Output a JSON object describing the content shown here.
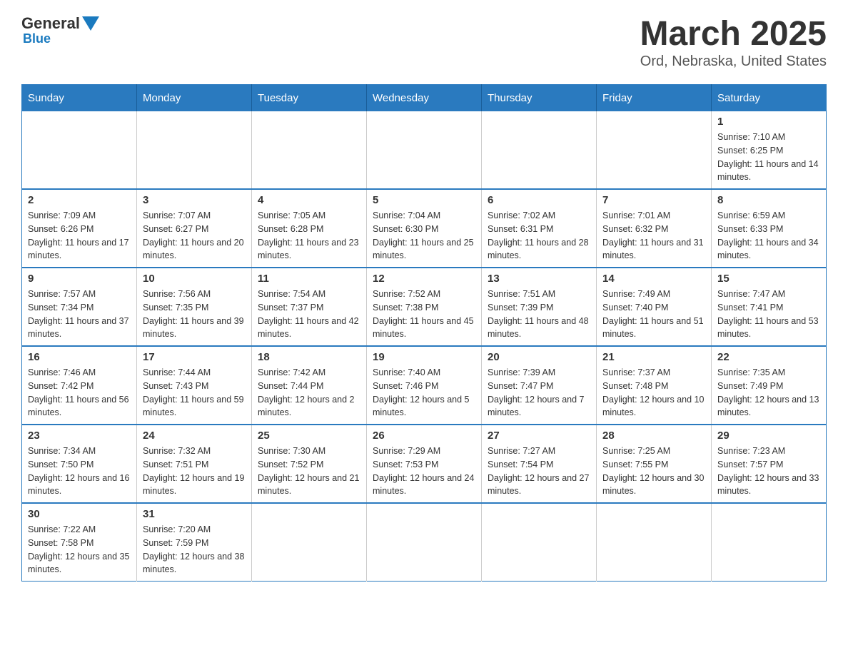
{
  "header": {
    "logo_general": "General",
    "logo_blue": "Blue",
    "main_title": "March 2025",
    "subtitle": "Ord, Nebraska, United States"
  },
  "days_of_week": [
    "Sunday",
    "Monday",
    "Tuesday",
    "Wednesday",
    "Thursday",
    "Friday",
    "Saturday"
  ],
  "weeks": [
    [
      {
        "day": "",
        "info": ""
      },
      {
        "day": "",
        "info": ""
      },
      {
        "day": "",
        "info": ""
      },
      {
        "day": "",
        "info": ""
      },
      {
        "day": "",
        "info": ""
      },
      {
        "day": "",
        "info": ""
      },
      {
        "day": "1",
        "info": "Sunrise: 7:10 AM\nSunset: 6:25 PM\nDaylight: 11 hours and 14 minutes."
      }
    ],
    [
      {
        "day": "2",
        "info": "Sunrise: 7:09 AM\nSunset: 6:26 PM\nDaylight: 11 hours and 17 minutes."
      },
      {
        "day": "3",
        "info": "Sunrise: 7:07 AM\nSunset: 6:27 PM\nDaylight: 11 hours and 20 minutes."
      },
      {
        "day": "4",
        "info": "Sunrise: 7:05 AM\nSunset: 6:28 PM\nDaylight: 11 hours and 23 minutes."
      },
      {
        "day": "5",
        "info": "Sunrise: 7:04 AM\nSunset: 6:30 PM\nDaylight: 11 hours and 25 minutes."
      },
      {
        "day": "6",
        "info": "Sunrise: 7:02 AM\nSunset: 6:31 PM\nDaylight: 11 hours and 28 minutes."
      },
      {
        "day": "7",
        "info": "Sunrise: 7:01 AM\nSunset: 6:32 PM\nDaylight: 11 hours and 31 minutes."
      },
      {
        "day": "8",
        "info": "Sunrise: 6:59 AM\nSunset: 6:33 PM\nDaylight: 11 hours and 34 minutes."
      }
    ],
    [
      {
        "day": "9",
        "info": "Sunrise: 7:57 AM\nSunset: 7:34 PM\nDaylight: 11 hours and 37 minutes."
      },
      {
        "day": "10",
        "info": "Sunrise: 7:56 AM\nSunset: 7:35 PM\nDaylight: 11 hours and 39 minutes."
      },
      {
        "day": "11",
        "info": "Sunrise: 7:54 AM\nSunset: 7:37 PM\nDaylight: 11 hours and 42 minutes."
      },
      {
        "day": "12",
        "info": "Sunrise: 7:52 AM\nSunset: 7:38 PM\nDaylight: 11 hours and 45 minutes."
      },
      {
        "day": "13",
        "info": "Sunrise: 7:51 AM\nSunset: 7:39 PM\nDaylight: 11 hours and 48 minutes."
      },
      {
        "day": "14",
        "info": "Sunrise: 7:49 AM\nSunset: 7:40 PM\nDaylight: 11 hours and 51 minutes."
      },
      {
        "day": "15",
        "info": "Sunrise: 7:47 AM\nSunset: 7:41 PM\nDaylight: 11 hours and 53 minutes."
      }
    ],
    [
      {
        "day": "16",
        "info": "Sunrise: 7:46 AM\nSunset: 7:42 PM\nDaylight: 11 hours and 56 minutes."
      },
      {
        "day": "17",
        "info": "Sunrise: 7:44 AM\nSunset: 7:43 PM\nDaylight: 11 hours and 59 minutes."
      },
      {
        "day": "18",
        "info": "Sunrise: 7:42 AM\nSunset: 7:44 PM\nDaylight: 12 hours and 2 minutes."
      },
      {
        "day": "19",
        "info": "Sunrise: 7:40 AM\nSunset: 7:46 PM\nDaylight: 12 hours and 5 minutes."
      },
      {
        "day": "20",
        "info": "Sunrise: 7:39 AM\nSunset: 7:47 PM\nDaylight: 12 hours and 7 minutes."
      },
      {
        "day": "21",
        "info": "Sunrise: 7:37 AM\nSunset: 7:48 PM\nDaylight: 12 hours and 10 minutes."
      },
      {
        "day": "22",
        "info": "Sunrise: 7:35 AM\nSunset: 7:49 PM\nDaylight: 12 hours and 13 minutes."
      }
    ],
    [
      {
        "day": "23",
        "info": "Sunrise: 7:34 AM\nSunset: 7:50 PM\nDaylight: 12 hours and 16 minutes."
      },
      {
        "day": "24",
        "info": "Sunrise: 7:32 AM\nSunset: 7:51 PM\nDaylight: 12 hours and 19 minutes."
      },
      {
        "day": "25",
        "info": "Sunrise: 7:30 AM\nSunset: 7:52 PM\nDaylight: 12 hours and 21 minutes."
      },
      {
        "day": "26",
        "info": "Sunrise: 7:29 AM\nSunset: 7:53 PM\nDaylight: 12 hours and 24 minutes."
      },
      {
        "day": "27",
        "info": "Sunrise: 7:27 AM\nSunset: 7:54 PM\nDaylight: 12 hours and 27 minutes."
      },
      {
        "day": "28",
        "info": "Sunrise: 7:25 AM\nSunset: 7:55 PM\nDaylight: 12 hours and 30 minutes."
      },
      {
        "day": "29",
        "info": "Sunrise: 7:23 AM\nSunset: 7:57 PM\nDaylight: 12 hours and 33 minutes."
      }
    ],
    [
      {
        "day": "30",
        "info": "Sunrise: 7:22 AM\nSunset: 7:58 PM\nDaylight: 12 hours and 35 minutes."
      },
      {
        "day": "31",
        "info": "Sunrise: 7:20 AM\nSunset: 7:59 PM\nDaylight: 12 hours and 38 minutes."
      },
      {
        "day": "",
        "info": ""
      },
      {
        "day": "",
        "info": ""
      },
      {
        "day": "",
        "info": ""
      },
      {
        "day": "",
        "info": ""
      },
      {
        "day": "",
        "info": ""
      }
    ]
  ]
}
